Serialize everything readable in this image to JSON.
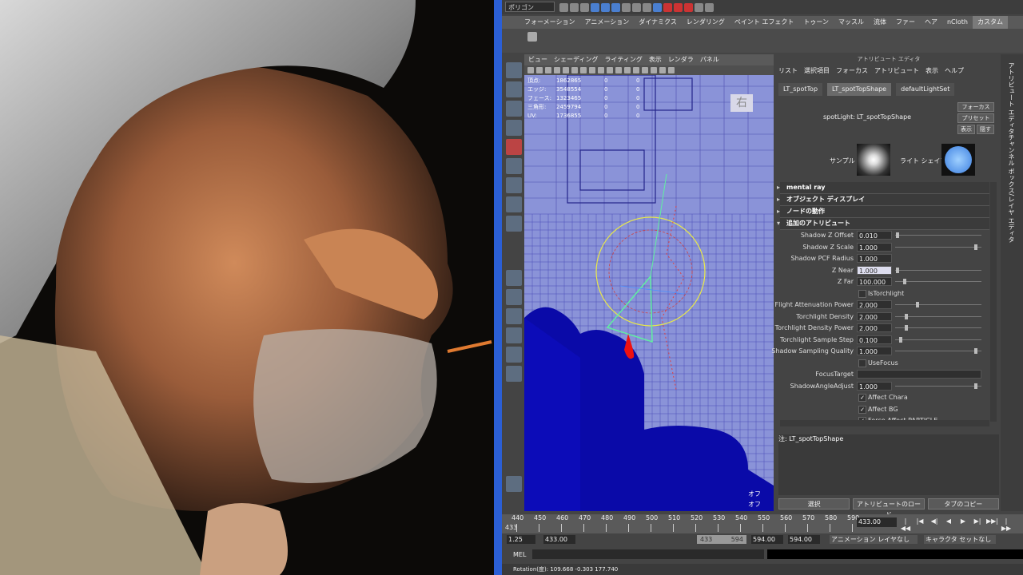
{
  "maya": {
    "mode": "ポリゴン",
    "shelf_tabs": [
      "ポリゴン",
      "フォーメーション",
      "アニメーション",
      "ダイナミクス",
      "レンダリング",
      "ペイント エフェクト",
      "トゥーン",
      "マッスル",
      "流体",
      "ファー",
      "ヘア",
      "nCloth",
      "カスタム"
    ],
    "shelf_active": "カスタム"
  },
  "viewport": {
    "menu": [
      "ビュー",
      "シェーディング",
      "ライティング",
      "表示",
      "レンダラ",
      "パネル"
    ],
    "hud": [
      {
        "label": "頂点:",
        "value": "1862865",
        "c1": "0",
        "c2": "0"
      },
      {
        "label": "エッジ:",
        "value": "3548554",
        "c1": "0",
        "c2": "0"
      },
      {
        "label": "フェース:",
        "value": "1323465",
        "c1": "0",
        "c2": "0"
      },
      {
        "label": "三角形:",
        "value": "2459794",
        "c1": "0",
        "c2": "0"
      },
      {
        "label": "UV:",
        "value": "1736855",
        "c1": "0",
        "c2": "0"
      }
    ],
    "view_label": "右",
    "corner_top": "オフ",
    "corner_bottom": "オフ"
  },
  "ae": {
    "title": "アトリビュート エディタ",
    "menu": [
      "リスト",
      "選択項目",
      "フォーカス",
      "アトリビュート",
      "表示",
      "ヘルプ"
    ],
    "tabs": [
      "LT_spotTop",
      "LT_spotTopShape",
      "defaultLightSet"
    ],
    "active_tab": "LT_spotTopShape",
    "node_label": "spotLight:",
    "node_value": "LT_spotTopShape",
    "btn_focus": "フォーカス",
    "btn_preset": "プリセット",
    "btn_show": "表示",
    "btn_hide": "隠す",
    "sample_label": "サンプル",
    "shape_label": "ライト シェイプ",
    "sections": [
      {
        "label": "mental ray",
        "open": false
      },
      {
        "label": "オブジェクト ディスプレイ",
        "open": false
      },
      {
        "label": "ノードの動作",
        "open": false
      },
      {
        "label": "追加のアトリビュート",
        "open": true
      }
    ],
    "attrs": [
      {
        "label": "Shadow Z Offset",
        "value": "0.010",
        "knob": 0.01
      },
      {
        "label": "Shadow Z Scale",
        "value": "1.000",
        "knob": 0.95
      },
      {
        "label": "Shadow PCF Radius",
        "value": "1.000",
        "knob": null
      },
      {
        "label": "Z Near",
        "value": "1.000",
        "knob": 0.01,
        "highlight": true
      },
      {
        "label": "Z Far",
        "value": "100.000",
        "knob": 0.1
      },
      {
        "check": "IsTorchlight",
        "checked": false
      },
      {
        "label": "Flight Attenuation Power",
        "value": "2.000",
        "knob": 0.25
      },
      {
        "label": "Torchlight Density",
        "value": "2.000",
        "knob": 0.12
      },
      {
        "label": "Torchlight Density Power",
        "value": "2.000",
        "knob": 0.12
      },
      {
        "label": "Torchlight Sample Step",
        "value": "0.100",
        "knob": 0.05
      },
      {
        "label": "Shadow Sampling Quality",
        "value": "1.000",
        "knob": 0.95
      },
      {
        "check": "UseFocus",
        "checked": false
      },
      {
        "label": "FocusTarget",
        "value": "",
        "knob": null
      },
      {
        "label": "ShadowAngleAdjust",
        "value": "1.000",
        "knob": 0.95
      },
      {
        "check": "Affect Chara",
        "checked": true
      },
      {
        "check": "Affect BG",
        "checked": true
      },
      {
        "check": "Force Affect PARTICLE",
        "checked": true
      }
    ],
    "notes_label": "注: LT_spotTopShape",
    "buttons": [
      "選択",
      "アトリビュートのロード",
      "タブのコピー"
    ]
  },
  "right_bar": [
    "アトリビュート エディタ",
    "チャンネル ボックス/レイヤ エディタ"
  ],
  "timeline": {
    "ticks": [
      "440",
      "450",
      "460",
      "470",
      "480",
      "490",
      "500",
      "510",
      "520",
      "530",
      "540",
      "550",
      "560",
      "570",
      "580",
      "590"
    ],
    "start_marker": "433",
    "current": "433.00",
    "controls": [
      "|◀◀",
      "|◀",
      "◀|",
      "◀",
      "▶",
      "▶|",
      "▶▶|",
      "|▶▶"
    ]
  },
  "range": {
    "fps": "1.25",
    "start": "433.00",
    "bar_start": "433",
    "bar_end": "594",
    "end": "594.00",
    "end2": "594.00",
    "anim_layer": "アニメーション レイヤなし",
    "char_set": "キャラクタ セットなし"
  },
  "mel": {
    "label": "MEL"
  },
  "status": {
    "text": "Rotation(度): 109.668   -0.303   177.740"
  }
}
